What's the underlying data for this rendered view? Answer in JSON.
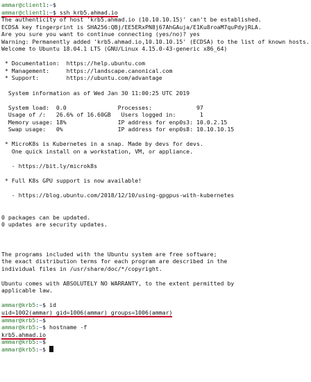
{
  "colors": {
    "user": "#2f7d32",
    "path": "#2a5fbf",
    "underline": "#c8102e",
    "cursor": "#111111"
  },
  "lines": [
    {
      "type": "prompt",
      "user": "ammar@client1",
      "path": "~",
      "cmd": ""
    },
    {
      "type": "prompt",
      "user": "ammar@client1",
      "path": "~",
      "cmd": "ssh krb5.ahmad.io",
      "underline": true
    },
    {
      "type": "text",
      "text": "The authenticity of host 'krb5.ahmad.io (10.10.10.15)' can't be established."
    },
    {
      "type": "text",
      "text": "ECDSA key fingerprint is SHA256:QBj/EE5ERxPN8j67AhGAuja/E1Ku8roaM7quPdyjRLA."
    },
    {
      "type": "text",
      "text": "Are you sure you want to continue connecting (yes/no)? yes"
    },
    {
      "type": "text",
      "text": "Warning: Permanently added 'krb5.ahmad.io,10.10.10.15' (ECDSA) to the list of known hosts."
    },
    {
      "type": "text",
      "text": "Welcome to Ubuntu 18.04.1 LTS (GNU/Linux 4.15.0-43-generic x86_64)"
    },
    {
      "type": "text",
      "text": ""
    },
    {
      "type": "text",
      "text": " * Documentation:  https://help.ubuntu.com"
    },
    {
      "type": "text",
      "text": " * Management:     https://landscape.canonical.com"
    },
    {
      "type": "text",
      "text": " * Support:        https://ubuntu.com/advantage"
    },
    {
      "type": "text",
      "text": ""
    },
    {
      "type": "text",
      "text": "  System information as of Wed Jan 30 11:00:25 UTC 2019"
    },
    {
      "type": "text",
      "text": ""
    },
    {
      "type": "text",
      "text": "  System load:  0.0               Processes:             97"
    },
    {
      "type": "text",
      "text": "  Usage of /:   26.6% of 16.60GB   Users logged in:       1"
    },
    {
      "type": "text",
      "text": "  Memory usage: 18%               IP address for enp0s3: 10.0.2.15"
    },
    {
      "type": "text",
      "text": "  Swap usage:   0%                IP address for enp0s8: 10.10.10.15"
    },
    {
      "type": "text",
      "text": ""
    },
    {
      "type": "text",
      "text": " * MicroK8s is Kubernetes in a snap. Made by devs for devs."
    },
    {
      "type": "text",
      "text": "   One quick install on a workstation, VM, or appliance."
    },
    {
      "type": "text",
      "text": ""
    },
    {
      "type": "text",
      "text": "   - https://bit.ly/microk8s"
    },
    {
      "type": "text",
      "text": ""
    },
    {
      "type": "text",
      "text": " * Full K8s GPU support is now available!"
    },
    {
      "type": "text",
      "text": ""
    },
    {
      "type": "text",
      "text": "   - https://blog.ubuntu.com/2018/12/10/using-gpgpus-with-kubernetes"
    },
    {
      "type": "text",
      "text": ""
    },
    {
      "type": "text",
      "text": ""
    },
    {
      "type": "text",
      "text": "0 packages can be updated."
    },
    {
      "type": "text",
      "text": "0 updates are security updates."
    },
    {
      "type": "text",
      "text": ""
    },
    {
      "type": "text",
      "text": ""
    },
    {
      "type": "text",
      "text": ""
    },
    {
      "type": "text",
      "text": "The programs included with the Ubuntu system are free software;"
    },
    {
      "type": "text",
      "text": "the exact distribution terms for each program are described in the"
    },
    {
      "type": "text",
      "text": "individual files in /usr/share/doc/*/copyright."
    },
    {
      "type": "text",
      "text": ""
    },
    {
      "type": "text",
      "text": "Ubuntu comes with ABSOLUTELY NO WARRANTY, to the extent permitted by"
    },
    {
      "type": "text",
      "text": "applicable law."
    },
    {
      "type": "text",
      "text": ""
    },
    {
      "type": "prompt",
      "user": "ammar@krb5",
      "path": "~",
      "cmd": "id"
    },
    {
      "type": "text",
      "text": "uid=1002(ammar) gid=1006(ammar) groups=1006(ammar)",
      "underline": true
    },
    {
      "type": "prompt",
      "user": "ammar@krb5",
      "path": "~",
      "cmd": ""
    },
    {
      "type": "prompt",
      "user": "ammar@krb5",
      "path": "~",
      "cmd": "hostname -f"
    },
    {
      "type": "text",
      "text": "krb5.ahmad.io",
      "underline": true
    },
    {
      "type": "prompt",
      "user": "ammar@krb5",
      "path": "~",
      "cmd": ""
    },
    {
      "type": "prompt",
      "user": "ammar@krb5",
      "path": "~",
      "cmd": "",
      "cursor": true
    }
  ]
}
